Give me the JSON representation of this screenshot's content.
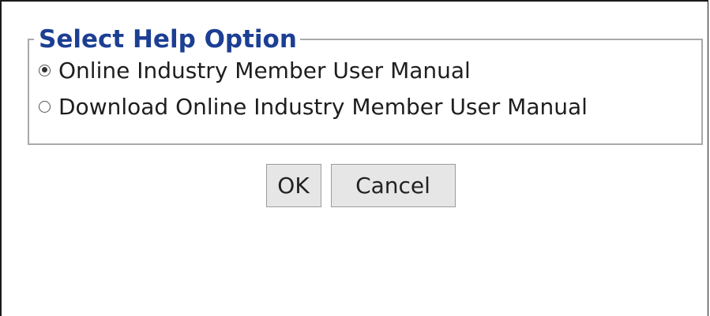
{
  "dialog": {
    "legend": "Select Help Option",
    "options": [
      {
        "label": "Online Industry Member User Manual",
        "selected": true
      },
      {
        "label": "Download Online Industry Member User Manual",
        "selected": false
      }
    ],
    "ok_label": "OK",
    "cancel_label": "Cancel"
  },
  "colors": {
    "legend_text": "#1c3f94",
    "button_bg": "#e6e6e6",
    "fieldset_border": "#a9a9a9"
  }
}
